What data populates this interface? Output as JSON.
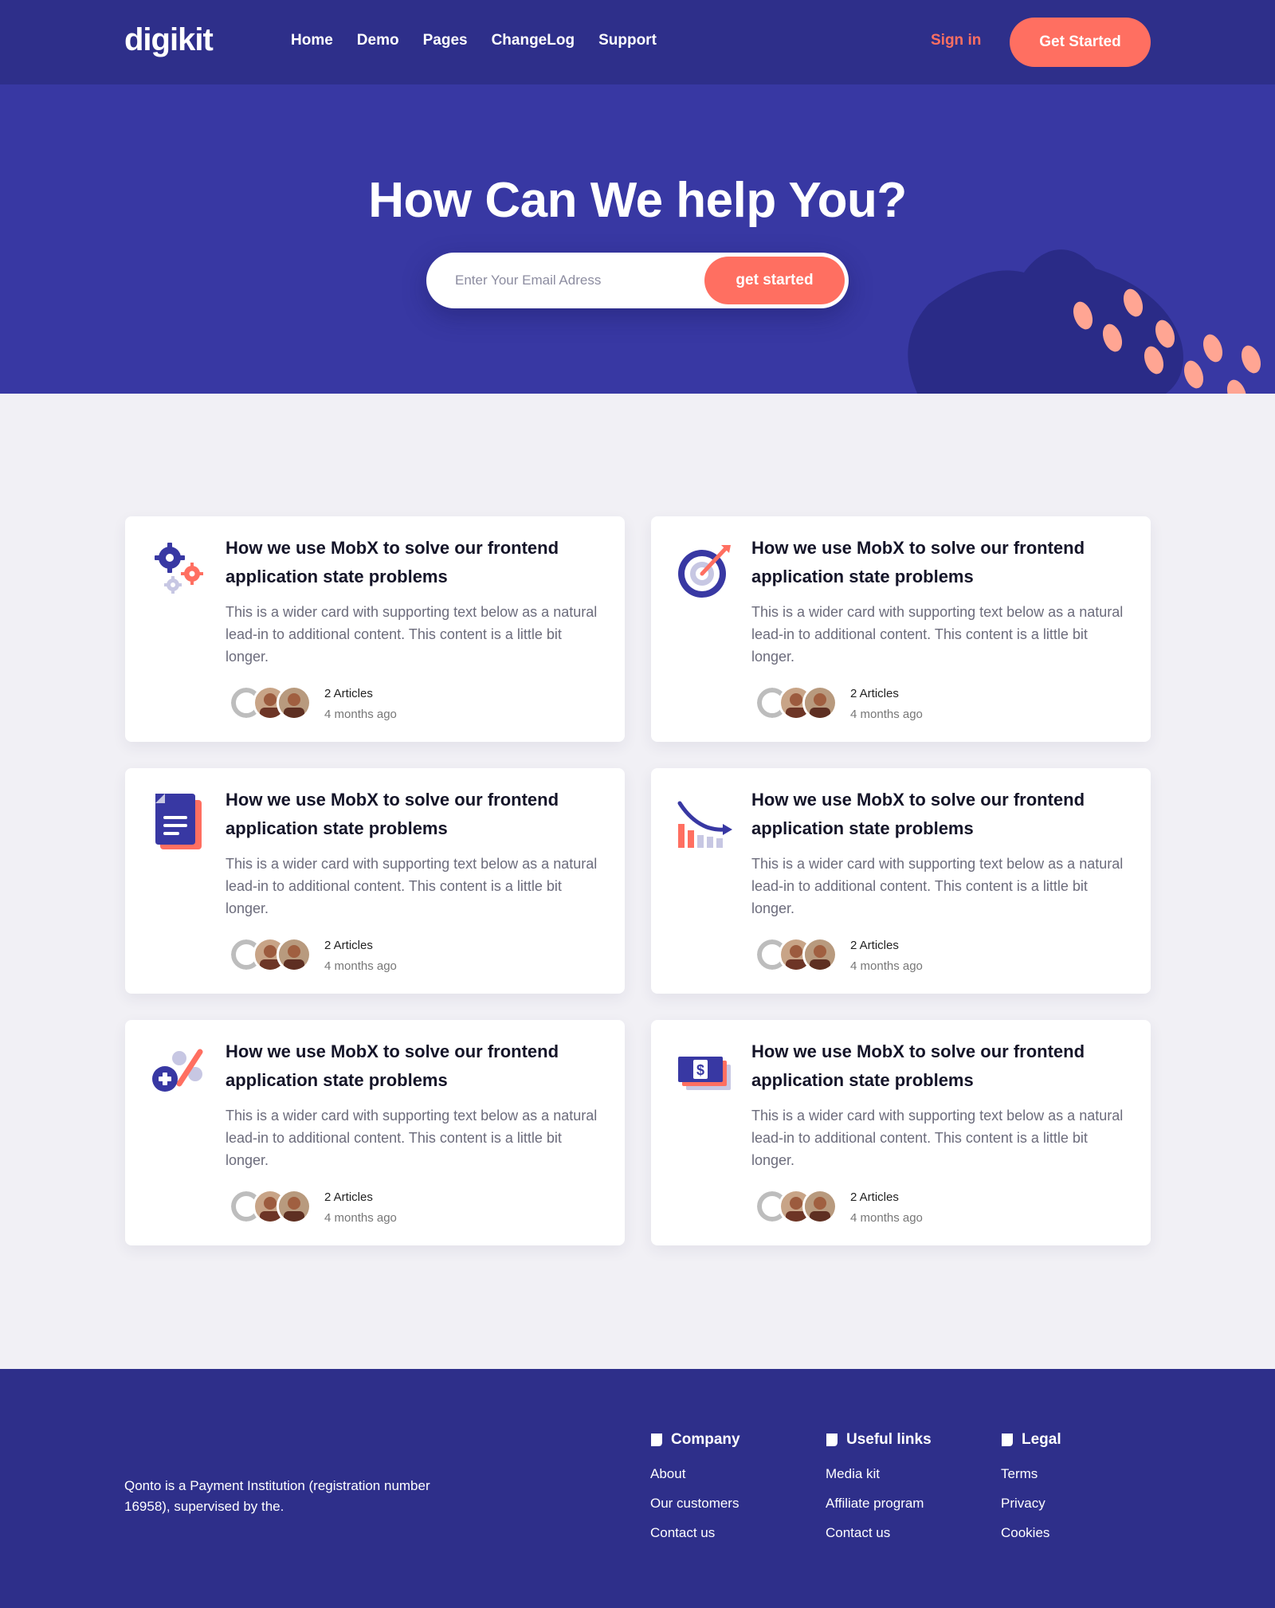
{
  "nav": {
    "logo": "digikit",
    "links": [
      "Home",
      "Demo",
      "Pages",
      "ChangeLog",
      "Support"
    ],
    "signin": "Sign in",
    "cta": "Get Started"
  },
  "hero": {
    "title": "How Can We help You?",
    "email_placeholder": "Enter Your Email Adress",
    "button": "get started"
  },
  "cards": [
    {
      "icon": "gears-icon",
      "title": "How we use MobX to solve our frontend application state problems",
      "text": "This is a wider card with supporting text below as a natural lead-in to additional content. This content is a little bit longer.",
      "articles": "2 Articles",
      "time": "4 months ago"
    },
    {
      "icon": "target-icon",
      "title": "How we use MobX to solve our frontend application state problems",
      "text": "This is a wider card with supporting text below as a natural lead-in to additional content. This content is a little bit longer.",
      "articles": "2 Articles",
      "time": "4 months ago"
    },
    {
      "icon": "document-icon",
      "title": "How we use MobX to solve our frontend application state problems",
      "text": "This is a wider card with supporting text below as a natural lead-in to additional content. This content is a little bit longer.",
      "articles": "2 Articles",
      "time": "4 months ago"
    },
    {
      "icon": "chart-decline-icon",
      "title": "How we use MobX to solve our frontend application state problems",
      "text": "This is a wider card with supporting text below as a natural lead-in to additional content. This content is a little bit longer.",
      "articles": "2 Articles",
      "time": "4 months ago"
    },
    {
      "icon": "math-operations-icon",
      "title": "How we use MobX to solve our frontend application state problems",
      "text": "This is a wider card with supporting text below as a natural lead-in to additional content. This content is a little bit longer.",
      "articles": "2 Articles",
      "time": "4 months ago"
    },
    {
      "icon": "money-bills-icon",
      "title": "How we use MobX to solve our frontend application state problems",
      "text": "This is a wider card with supporting text below as a natural lead-in to additional content. This content is a little bit longer.",
      "articles": "2 Articles",
      "time": "4 months ago"
    }
  ],
  "footer": {
    "about": "Qonto is a Payment Institution (registration number 16958), supervised by the.",
    "columns": [
      {
        "title": "Company",
        "links": [
          "About",
          "Our customers",
          "Contact us"
        ]
      },
      {
        "title": "Useful links",
        "links": [
          "Media kit",
          "Affiliate program",
          "Contact us"
        ]
      },
      {
        "title": "Legal",
        "links": [
          "Terms",
          "Privacy",
          "Cookies"
        ]
      }
    ]
  },
  "colors": {
    "nav_bg": "#2e2f8a",
    "hero_bg": "#3838a3",
    "accent": "#ff6f61",
    "page_bg": "#f1f0f5"
  }
}
